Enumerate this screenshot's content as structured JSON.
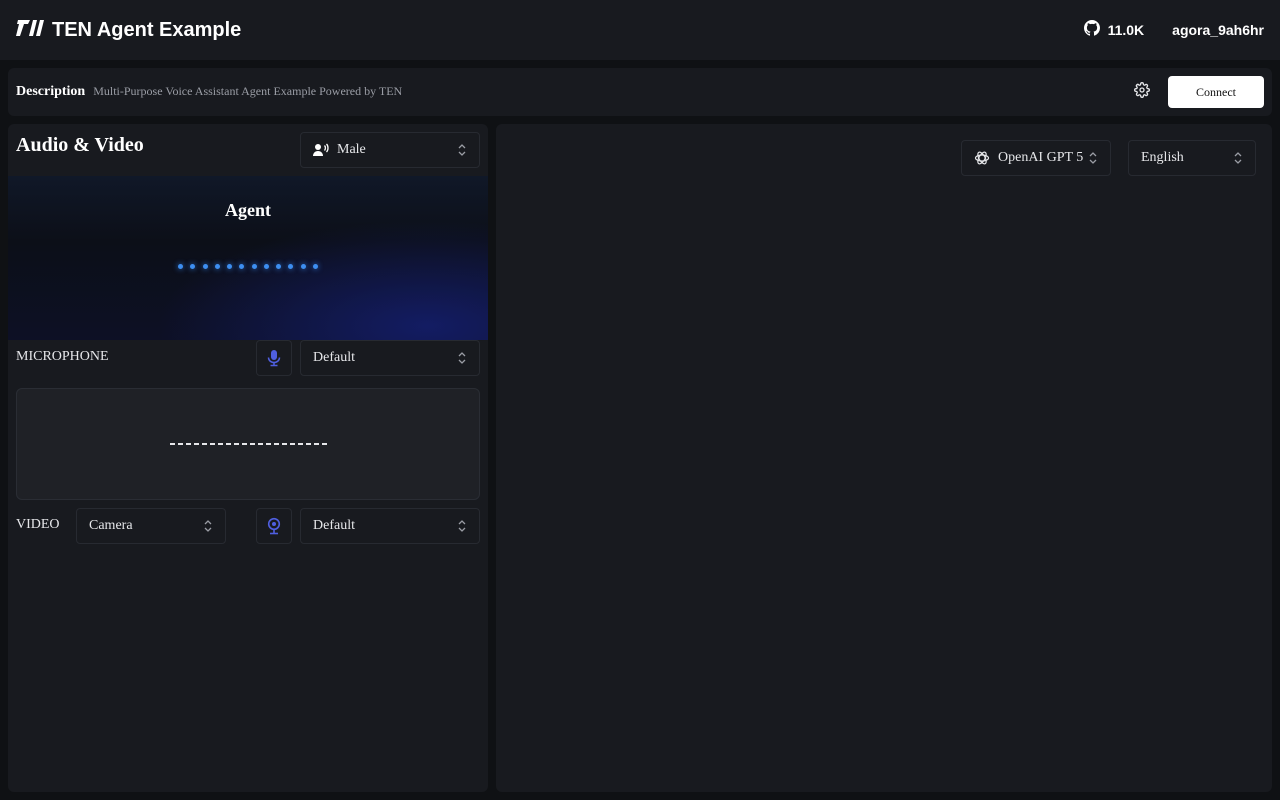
{
  "header": {
    "title": "TEN Agent Example",
    "github_stars": "11.0K",
    "user": "agora_9ah6hr"
  },
  "description_bar": {
    "label": "Description",
    "text": "Multi-Purpose Voice Assistant Agent Example Powered by TEN",
    "connect_label": "Connect"
  },
  "audio_video": {
    "title": "Audio & Video",
    "voice_select": "Male",
    "agent_label": "Agent",
    "microphone_label": "MICROPHONE",
    "microphone_device": "Default",
    "video_label": "VIDEO",
    "video_source": "Camera",
    "video_device": "Default"
  },
  "chat": {
    "model_select": "OpenAI GPT 5",
    "language_select": "English"
  },
  "colors": {
    "accent_blue": "#3d8ef0",
    "icon_indigo": "#4f5fe0",
    "panel_bg": "#181a1f",
    "page_bg": "#0f1114"
  }
}
